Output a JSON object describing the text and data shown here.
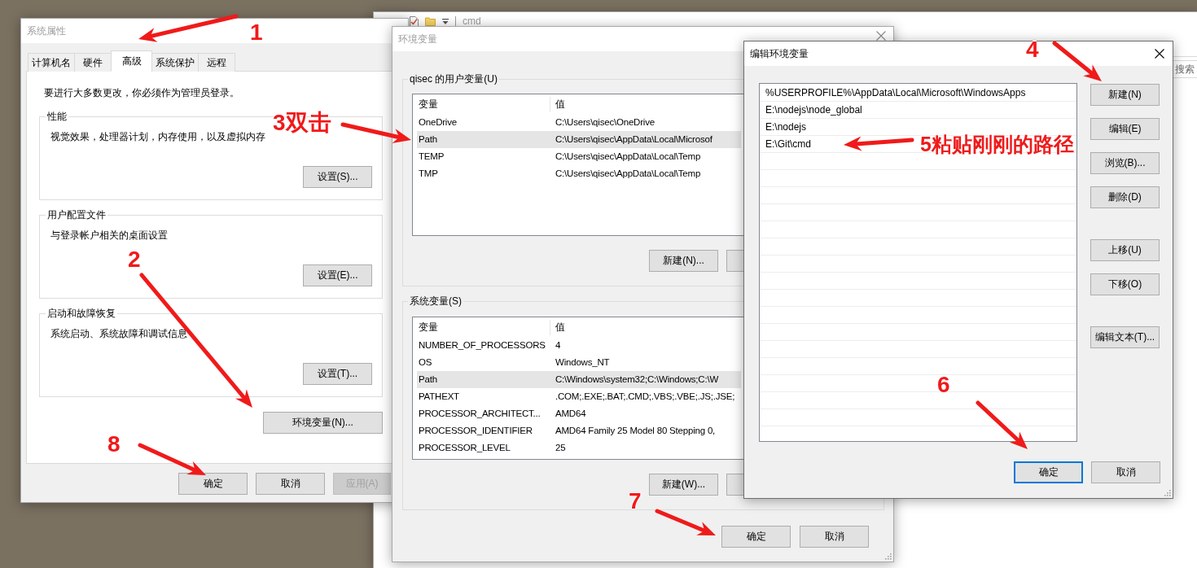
{
  "explorer_window": {
    "title": "cmd",
    "active": false,
    "search": {
      "placeholder": "搜索"
    }
  },
  "system_properties": {
    "title": "系统属性",
    "active": false,
    "tabs": [
      {
        "label": "计算机名",
        "selected": false
      },
      {
        "label": "硬件",
        "selected": false
      },
      {
        "label": "高级",
        "selected": true
      },
      {
        "label": "系统保护",
        "selected": false
      },
      {
        "label": "远程",
        "selected": false
      }
    ],
    "notice": "要进行大多数更改，你必须作为管理员登录。",
    "groups": [
      {
        "title": "性能",
        "description": "视觉效果，处理器计划，内存使用，以及虚拟内存",
        "button": "设置(S)..."
      },
      {
        "title": "用户配置文件",
        "description": "与登录帐户相关的桌面设置",
        "button": "设置(E)..."
      },
      {
        "title": "启动和故障恢复",
        "description": "系统启动、系统故障和调试信息",
        "button": "设置(T)..."
      }
    ],
    "environment_button": "环境变量(N)...",
    "buttons": [
      {
        "label": "确定",
        "disabled": false
      },
      {
        "label": "取消",
        "disabled": false
      },
      {
        "label": "应用(A)",
        "disabled": true
      }
    ]
  },
  "environment_variables": {
    "title": "环境变量",
    "active": false,
    "sections": [
      {
        "title": "qisec 的用户变量(U)",
        "columns": [
          "变量",
          "值"
        ],
        "rows": [
          {
            "name": "OneDrive",
            "value": "C:\\Users\\qisec\\OneDrive",
            "selected": false
          },
          {
            "name": "Path",
            "value": "C:\\Users\\qisec\\AppData\\Local\\Microsof",
            "selected": true
          },
          {
            "name": "TEMP",
            "value": "C:\\Users\\qisec\\AppData\\Local\\Temp",
            "selected": false
          },
          {
            "name": "TMP",
            "value": "C:\\Users\\qisec\\AppData\\Local\\Temp",
            "selected": false
          }
        ],
        "button": "新建(N)..."
      },
      {
        "title": "系统变量(S)",
        "columns": [
          "变量",
          "值"
        ],
        "rows": [
          {
            "name": "NUMBER_OF_PROCESSORS",
            "value": "4",
            "selected": false
          },
          {
            "name": "OS",
            "value": "Windows_NT",
            "selected": false
          },
          {
            "name": "Path",
            "value": "C:\\Windows\\system32;C:\\Windows;C:\\W",
            "selected": true
          },
          {
            "name": "PATHEXT",
            "value": ".COM;.EXE;.BAT;.CMD;.VBS;.VBE;.JS;.JSE;",
            "selected": false
          },
          {
            "name": "PROCESSOR_ARCHITECT...",
            "value": "AMD64",
            "selected": false
          },
          {
            "name": "PROCESSOR_IDENTIFIER",
            "value": "AMD64 Family 25 Model 80 Stepping 0,",
            "selected": false
          },
          {
            "name": "PROCESSOR_LEVEL",
            "value": "25",
            "selected": false
          }
        ],
        "button": "新建(W)..."
      }
    ],
    "buttons": [
      {
        "label": "确定",
        "default": false
      },
      {
        "label": "取消",
        "default": false
      }
    ]
  },
  "edit_environment_variable": {
    "title": "编辑环境变量",
    "active": true,
    "entries": [
      {
        "text": "%USERPROFILE%\\AppData\\Local\\Microsoft\\WindowsApps",
        "selected": false
      },
      {
        "text": "E:\\nodejs\\node_global",
        "selected": false
      },
      {
        "text": "E:\\nodejs",
        "selected": false
      },
      {
        "text": "E:\\Git\\cmd",
        "selected": false
      }
    ],
    "side_buttons": [
      [
        "新建(N)",
        "编辑(E)",
        "浏览(B)...",
        "删除(D)"
      ],
      [
        "上移(U)",
        "下移(O)"
      ],
      [
        "编辑文本(T)..."
      ]
    ],
    "buttons": [
      {
        "label": "确定",
        "default": true
      },
      {
        "label": "取消",
        "default": false
      }
    ]
  },
  "annotations": [
    {
      "label": "1"
    },
    {
      "label": "2"
    },
    {
      "label": "3双击"
    },
    {
      "label": "4"
    },
    {
      "label": "5粘贴刚刚的路径"
    },
    {
      "label": "6"
    },
    {
      "label": "7"
    },
    {
      "label": "8"
    }
  ]
}
